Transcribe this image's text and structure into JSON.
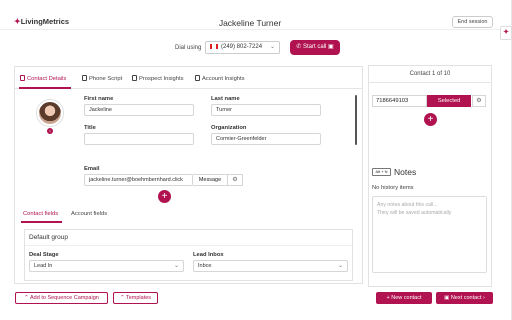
{
  "header": {
    "logo_text": "LivingMetrics",
    "contact_name": "Jackeline Turner",
    "end_session": "End session"
  },
  "dial": {
    "label": "Dial using",
    "phone": "(249) 802-7224",
    "start_call": "Start call"
  },
  "tabs": [
    {
      "label": "Contact Details",
      "active": true
    },
    {
      "label": "Phone Script",
      "active": false
    },
    {
      "label": "Prospect Insights",
      "active": false
    },
    {
      "label": "Account Insights",
      "active": false
    }
  ],
  "contact": {
    "first_name_label": "First name",
    "first_name": "Jackeline",
    "last_name_label": "Last name",
    "last_name": "Turner",
    "title_label": "Title",
    "title": "",
    "organization_label": "Organization",
    "organization": "Cormier-Greenfelder",
    "email_label": "Email",
    "email": "jackeline.turner@boehmbernhard.click",
    "message_button": "Message"
  },
  "subtabs": [
    {
      "label": "Contact fields",
      "active": true
    },
    {
      "label": "Account fields",
      "active": false
    }
  ],
  "group": {
    "title": "Default group",
    "deal_stage_label": "Deal Stage",
    "deal_stage_value": "Lead In",
    "lead_inbox_label": "Lead Inbox",
    "lead_inbox_value": "Inbox"
  },
  "bottom": {
    "add_sequence": "Add to Sequence Campaign",
    "templates": "Templates",
    "new_contact": "New contact",
    "next_contact": "Next contact"
  },
  "right": {
    "contact_counter": "Contact 1 of 10",
    "phone_value": "7186649103",
    "selected_label": "Selected",
    "notes_shortcut": "Alt + N",
    "notes_title": "Notes",
    "no_history": "No history items",
    "notes_placeholder_1": "Any notes about this call...",
    "notes_placeholder_2": "They will be saved automatically"
  },
  "colors": {
    "accent": "#b0134f"
  }
}
